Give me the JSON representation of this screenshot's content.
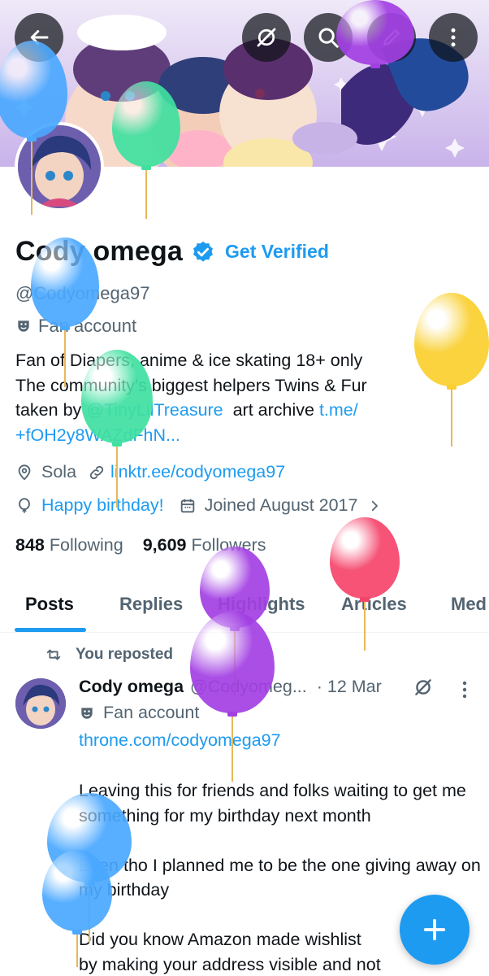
{
  "profile": {
    "display_name": "Cody omega",
    "get_verified": "Get Verified",
    "handle": "@Codyomega97",
    "category": "Fan account",
    "bio": {
      "text1": "Fan of Diapers, anime & ice skating 18+ only",
      "text2": "The community's biggest helpers Twins & Fur",
      "text3_prefix": "taken by ",
      "mention": "@TinyLilTreasure",
      "text3_mid": "  art archive ",
      "link_part1": "t.me/",
      "link_part2": "+fOH2y8WAZdFhN..."
    },
    "location": "Sola",
    "website": "linktr.ee/codyomega97",
    "birthday": "Happy birthday!",
    "joined": "Joined August 2017",
    "following_count": "848",
    "following_label": "Following",
    "followers_count": "9,609",
    "followers_label": "Followers"
  },
  "tabs": [
    {
      "label": "Posts"
    },
    {
      "label": "Replies"
    },
    {
      "label": "Highlights"
    },
    {
      "label": "Articles"
    },
    {
      "label": "Med"
    }
  ],
  "post": {
    "repost_label": "You reposted",
    "author": "Cody omega",
    "handle": "@Codyomeg...",
    "time": "· 12 Mar",
    "category": "Fan account",
    "link": "throne.com/codyomega97",
    "text": "Leaving this for friends and folks waiting to get me something for my birthday next month\n\nEven tho I planned me to be the one giving away on my birthday\n\nDid you know Amazon made wishlist\nby making your address visible and not"
  },
  "icons": {
    "back": "back-arrow-icon",
    "mute": "mute-icon",
    "search": "search-icon",
    "edit": "edit-icon",
    "more": "more-vertical-icon",
    "verified": "verified-badge-icon",
    "fan": "theater-mask-icon",
    "location": "location-pin-icon",
    "link": "link-icon",
    "balloon": "balloon-icon",
    "calendar": "calendar-icon",
    "chevron": "chevron-right-icon",
    "repost": "repost-icon",
    "compose": "plus-icon"
  },
  "colors": {
    "accent": "#1d9bf0",
    "text": "#0f1419",
    "secondary": "#536471",
    "balloon_blue": "#4aa8ff",
    "balloon_green": "#3fe0a0",
    "balloon_purple": "#a23fe3",
    "balloon_yellow": "#f9cf2e",
    "balloon_red": "#f5446b"
  }
}
